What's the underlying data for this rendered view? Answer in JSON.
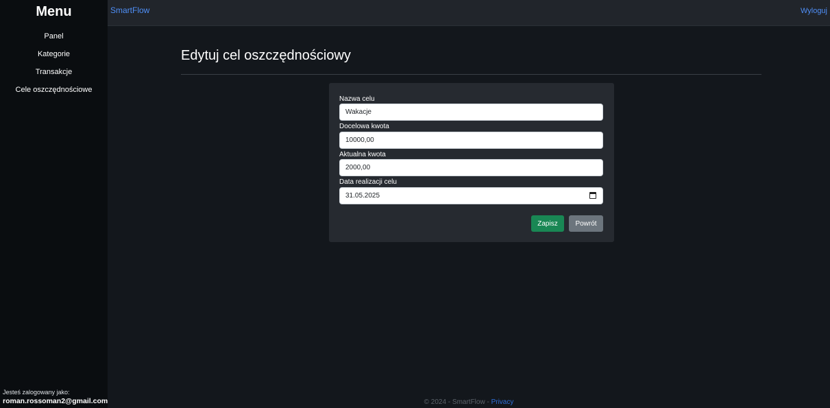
{
  "sidebar": {
    "title": "Menu",
    "items": [
      {
        "label": "Panel"
      },
      {
        "label": "Kategorie"
      },
      {
        "label": "Transakcje"
      },
      {
        "label": "Cele oszczędnościowe"
      }
    ],
    "logged_label": "Jesteś zalogowany jako:",
    "logged_email": "roman.rossoman2@gmail.com"
  },
  "topbar": {
    "brand": "SmartFlow",
    "logout": "Wyloguj"
  },
  "page": {
    "title": "Edytuj cel oszczędnościowy"
  },
  "form": {
    "name_label": "Nazwa celu",
    "name_value": "Wakacje",
    "target_label": "Docelowa kwota",
    "target_value": "10000,00",
    "current_label": "Aktualna kwota",
    "current_value": "2000,00",
    "date_label": "Data realizacji celu",
    "date_value": "31.05.2025",
    "save_label": "Zapisz",
    "back_label": "Powrót"
  },
  "footer": {
    "text": "© 2024 - SmartFlow - ",
    "privacy": "Privacy"
  },
  "colors": {
    "accent": "#4f8ff7",
    "success": "#198754",
    "secondary": "#6c757d"
  }
}
